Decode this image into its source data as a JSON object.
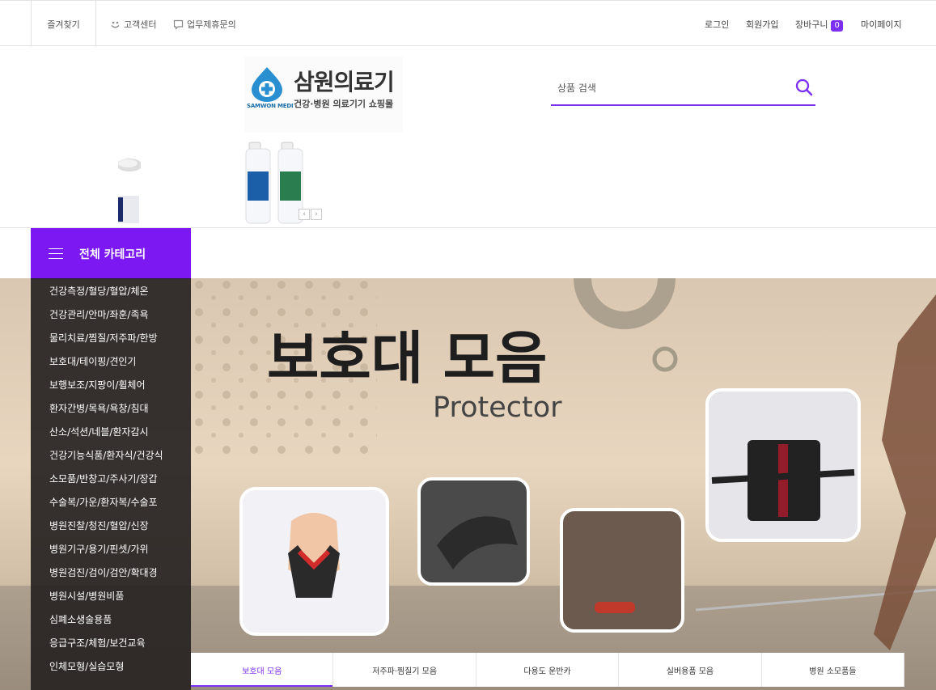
{
  "topbar": {
    "favorites": "즐겨찾기",
    "customer_center": "고객센터",
    "partnership": "업무제휴문의",
    "login": "로그인",
    "signup": "회원가입",
    "cart": "장바구니",
    "cart_count": "0",
    "mypage": "마이페이지"
  },
  "logo": {
    "name": "삼원의료기",
    "subtitle": "건강·병원 의료기기 쇼핑몰",
    "mark_text": "SAMWON MEDI"
  },
  "search": {
    "placeholder": "상품 검색"
  },
  "category": {
    "title": "전체 카테고리",
    "items": [
      "건강측정/혈당/혈압/체온",
      "건강관리/안마/좌훈/족욕",
      "물리치료/찜질/저주파/한방",
      "보호대/테이핑/견인기",
      "보행보조/지팡이/휠체어",
      "환자간병/목욕/욕창/침대",
      "산소/석션/네블/환자감시",
      "건강기능식품/환자식/건강식",
      "소모품/반창고/주사기/장갑",
      "수술복/가운/환자복/수술포",
      "병원진찰/청진/혈압/신장",
      "병원기구/용기/핀셋/가위",
      "병원검진/검이/검안/확대경",
      "병원시설/병원비품",
      "심폐소생술용품",
      "응급구조/체험/보건교육",
      "인체모형/실습모형"
    ]
  },
  "banner": {
    "title": "보호대 모음",
    "subtitle": "Protector"
  },
  "tabs": [
    "보호대 모음",
    "저주파·찜질기 모음",
    "다용도 운반카",
    "실버용품 모음",
    "병원 소모품들"
  ],
  "colors": {
    "accent": "#7b2ff2",
    "category_header": "#7c19f3"
  }
}
